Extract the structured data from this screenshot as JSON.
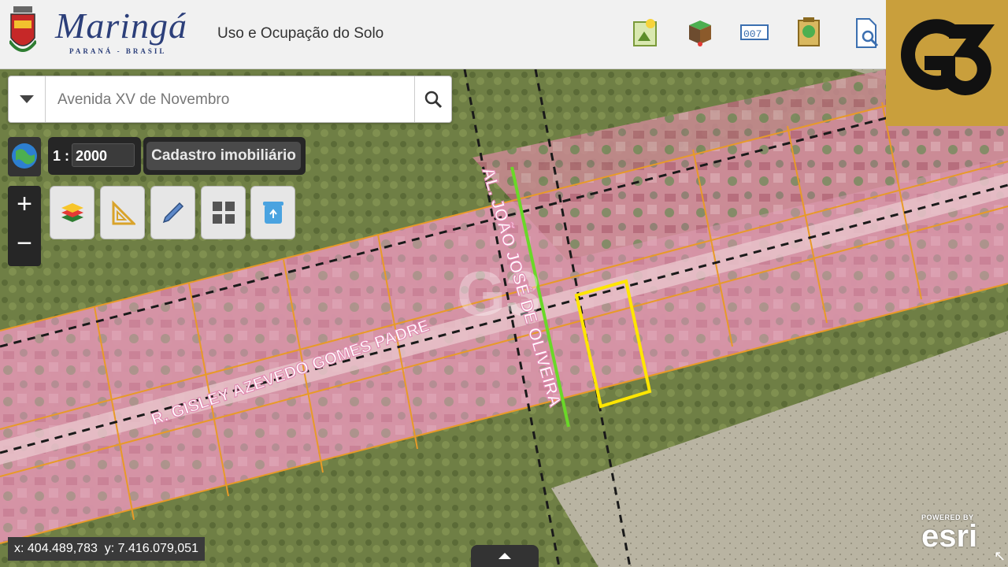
{
  "header": {
    "logo_text": "Maringá",
    "logo_sub": "PARANÁ - BRASIL",
    "title": "Uso e Ocupação do Solo",
    "icons": [
      "map-legend-icon",
      "terrain-layer-icon",
      "counter-icon",
      "document-icon",
      "search-document-icon"
    ]
  },
  "brand": {
    "name": "G3",
    "color": "#c99f3c"
  },
  "search": {
    "placeholder": "Avenida XV de Novembro",
    "value": ""
  },
  "scale": {
    "prefix": "1 :",
    "value": "2000"
  },
  "layer_button": {
    "label": "Cadastro imobiliário"
  },
  "zoom": {
    "in": "+",
    "out": "−"
  },
  "tools": [
    "layers-icon",
    "ruler-icon",
    "pencil-icon",
    "grid-icon",
    "recycle-bin-icon"
  ],
  "map": {
    "street_labels": [
      "AL. JOÃO JOSÉ DE OLIVEIRA",
      "R. GISLEY AZEVEDO GOMES PADRE"
    ],
    "watermark": "G3",
    "colors": {
      "parcel_overlay": "#e8a0c0",
      "parcel_border": "#e89a28",
      "highlight": "#ffe600",
      "green_line": "#6ad828"
    }
  },
  "coordinates": {
    "x": "x: 404.489,783",
    "y": "y: 7.416.079,051"
  },
  "esri": {
    "powered": "POWERED BY",
    "name": "esri"
  }
}
